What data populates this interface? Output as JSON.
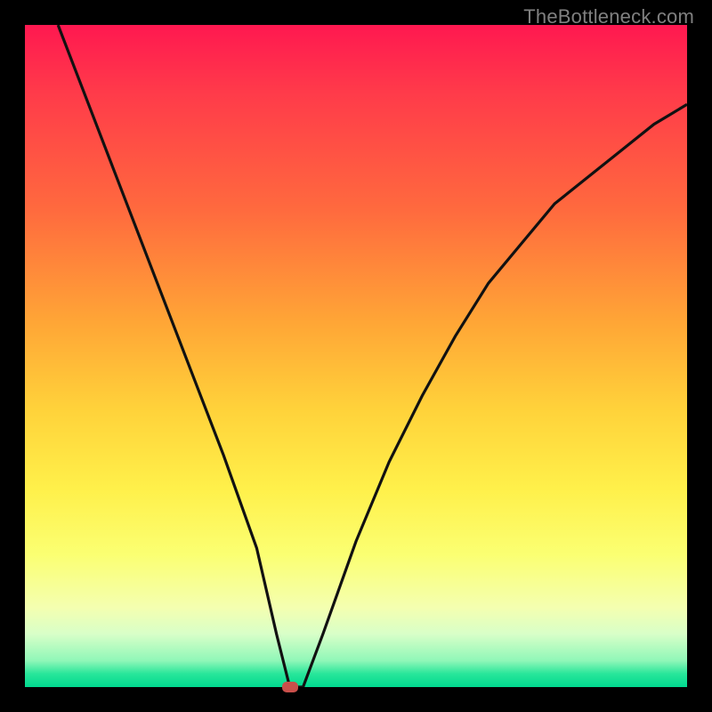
{
  "watermark": "TheBottleneck.com",
  "colors": {
    "frame_bg": "#000000",
    "watermark_text": "#808080",
    "curve_stroke": "#111111",
    "marker_fill": "#c94f4a",
    "gradient_top": "#ff1850",
    "gradient_bottom": "#00d98f"
  },
  "chart_data": {
    "type": "line",
    "title": "",
    "xlabel": "",
    "ylabel": "",
    "xlim": [
      0,
      100
    ],
    "ylim": [
      0,
      100
    ],
    "min_point": {
      "x": 40,
      "y": 0
    },
    "series": [
      {
        "name": "curve",
        "x": [
          5,
          10,
          15,
          20,
          25,
          30,
          35,
          38,
          40,
          42,
          45,
          50,
          55,
          60,
          65,
          70,
          75,
          80,
          85,
          90,
          95,
          100
        ],
        "y": [
          100,
          87,
          74,
          61,
          48,
          35,
          21,
          8,
          0,
          0,
          8,
          22,
          34,
          44,
          53,
          61,
          67,
          73,
          77,
          81,
          85,
          88
        ]
      }
    ],
    "marker": {
      "x": 40,
      "y": 0
    }
  }
}
